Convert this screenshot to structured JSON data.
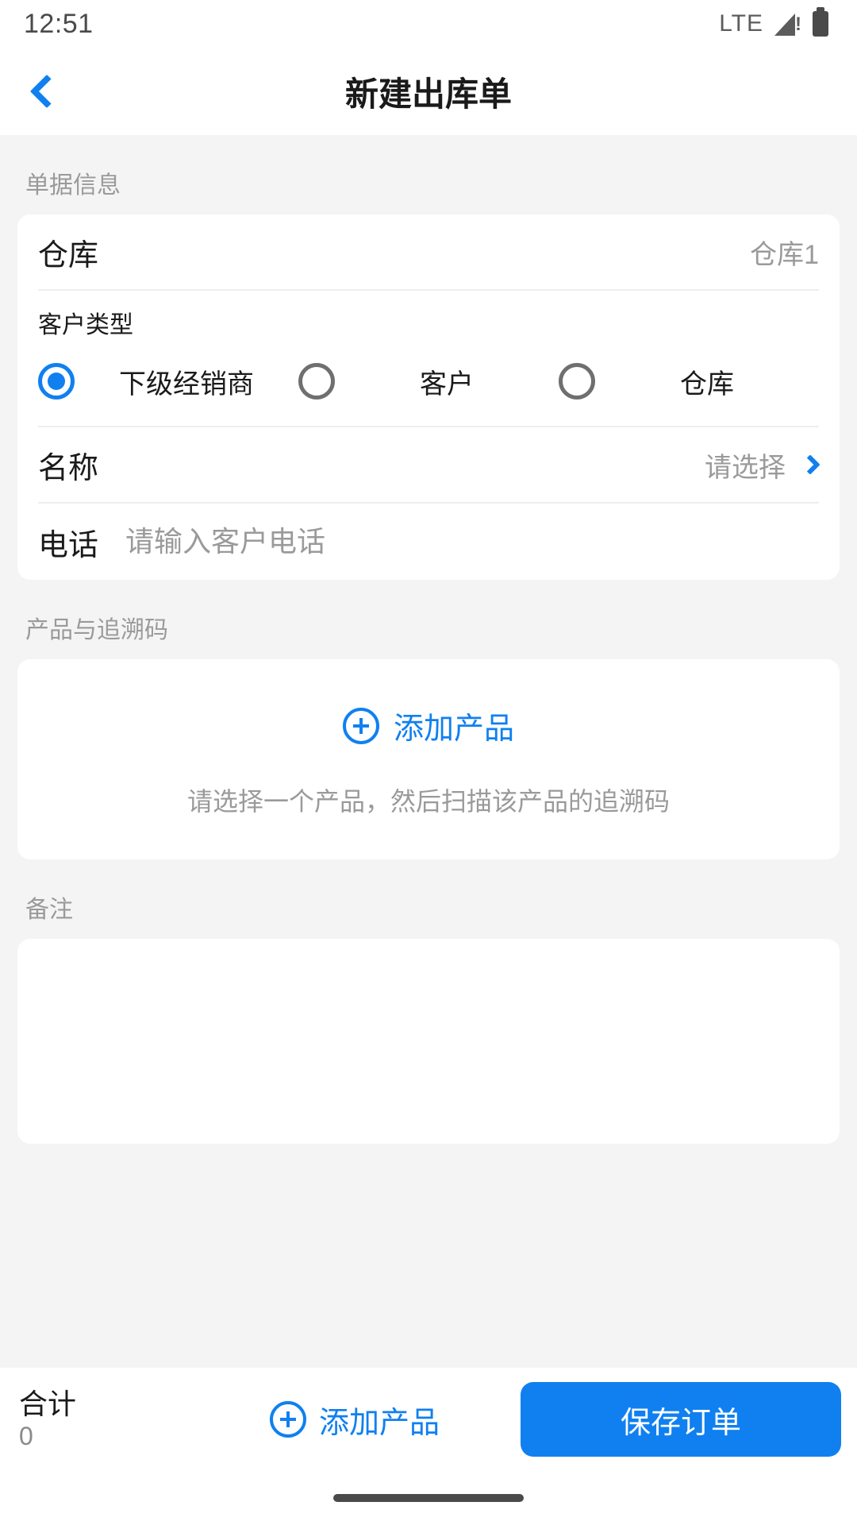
{
  "status_bar": {
    "time": "12:51",
    "network": "LTE",
    "signal_icon": "signal-warning-icon",
    "battery_icon": "battery-icon"
  },
  "header": {
    "back_icon": "chevron-left-icon",
    "title": "新建出库单"
  },
  "sections": {
    "doc_info": {
      "label": "单据信息",
      "warehouse": {
        "label": "仓库",
        "value": "仓库1"
      },
      "customer_type": {
        "label": "客户类型",
        "options": [
          {
            "label": "下级经销商",
            "selected": true
          },
          {
            "label": "客户",
            "selected": false
          },
          {
            "label": "仓库",
            "selected": false
          }
        ]
      },
      "name": {
        "label": "名称",
        "placeholder": "请选择",
        "chevron_icon": "chevron-right-icon"
      },
      "phone": {
        "label": "电话",
        "placeholder": "请输入客户电话",
        "value": ""
      }
    },
    "products": {
      "label": "产品与追溯码",
      "add_label": "添加产品",
      "add_icon": "plus-circle-icon",
      "hint": "请选择一个产品，然后扫描该产品的追溯码"
    },
    "notes": {
      "label": "备注",
      "placeholder": "",
      "value": ""
    }
  },
  "bottom_bar": {
    "total_label": "合计",
    "total_value": "0",
    "add_label": "添加产品",
    "add_icon": "plus-circle-icon",
    "save_label": "保存订单"
  },
  "colors": {
    "accent": "#1080f0",
    "page_bg": "#f4f4f4",
    "card_bg": "#ffffff",
    "muted_text": "#9a9a9a"
  }
}
